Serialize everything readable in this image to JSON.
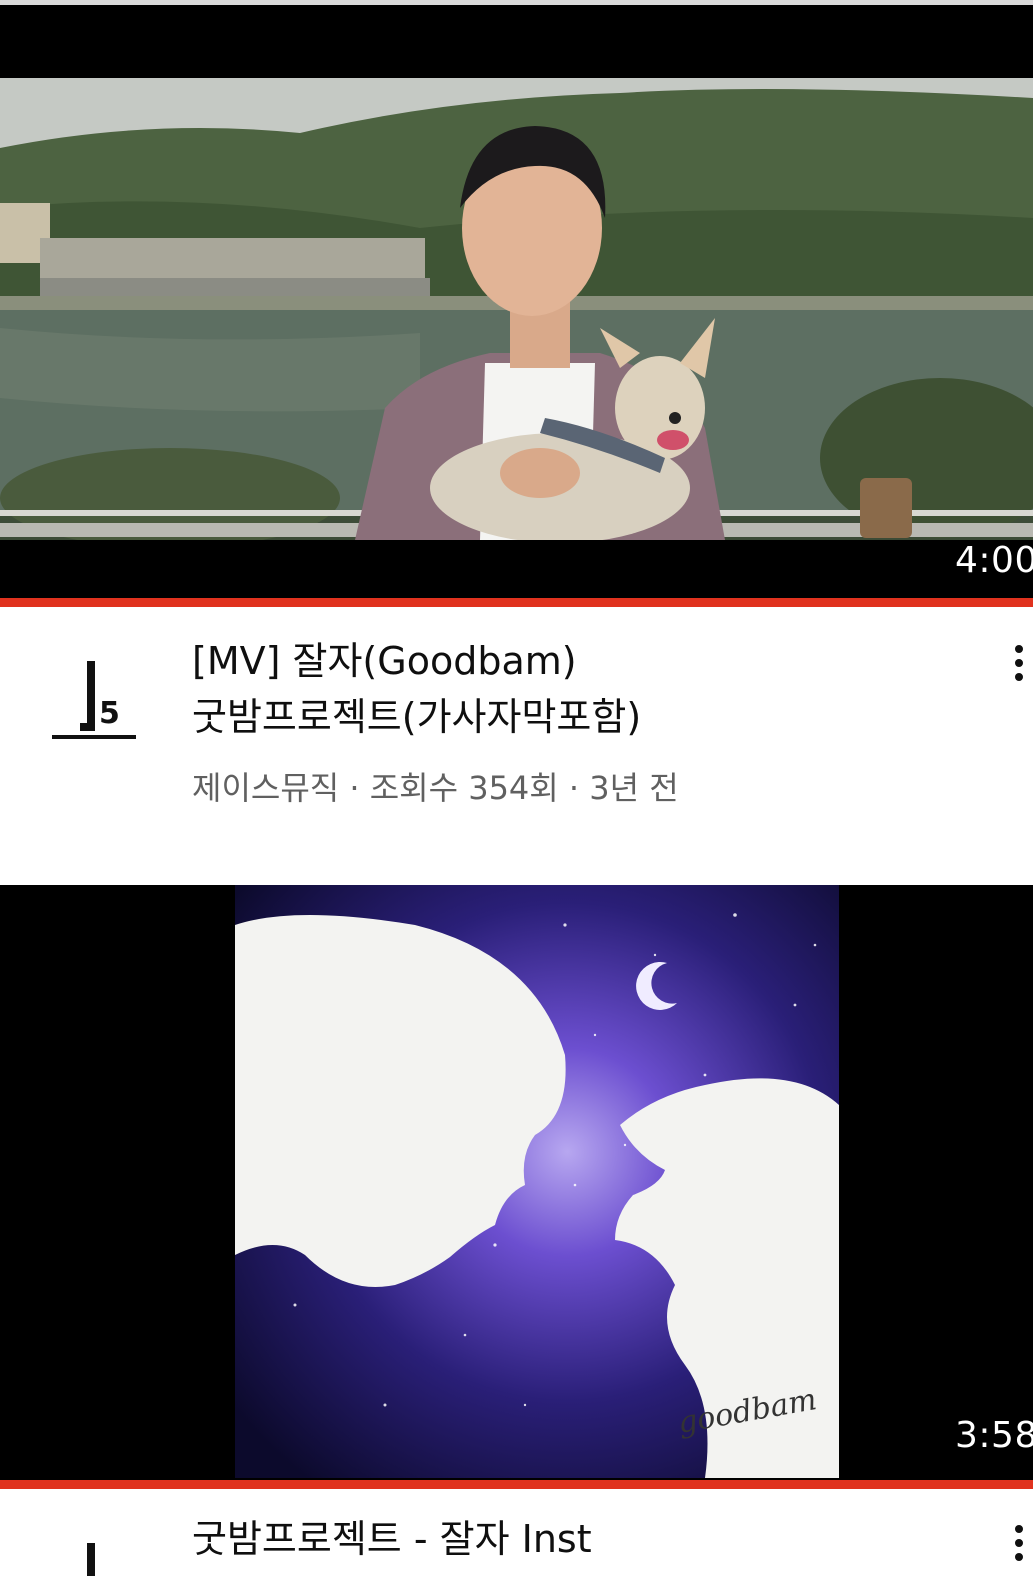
{
  "videos": [
    {
      "duration": "4:00",
      "title_line1": "[MV] 잘자(Goodbam)",
      "title_line2": "굿밤프로젝트(가사자막포함)",
      "channel": "제이스뮤직",
      "views": "조회수 354회",
      "age": "3년 전",
      "watched_progress": 1.0
    },
    {
      "duration": "3:58",
      "title_line1": "굿밤프로젝트 - 잘자 Inst",
      "signature": "goodbam",
      "watched_progress": 1.0
    }
  ],
  "separator": " · ",
  "colors": {
    "progress": "#e0321e",
    "meta_text": "#606060",
    "title_text": "#0f0f0f"
  },
  "icons": {
    "menu": "more-vert-icon"
  }
}
